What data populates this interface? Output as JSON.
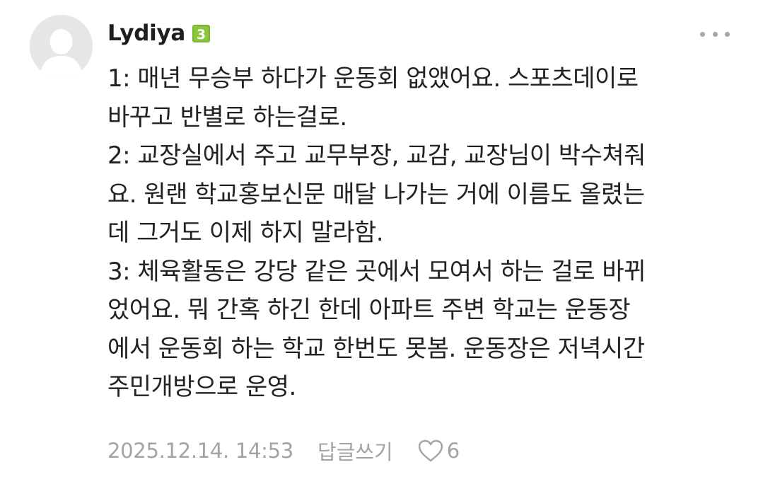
{
  "comment": {
    "author": "Lydiya",
    "level_badge": "3",
    "body_lines": [
      "1: 매년 무승부 하다가 운동회 없앴어요. 스포츠데이로",
      "바꾸고 반별로 하는걸로.",
      "2: 교장실에서 주고 교무부장, 교감, 교장님이 박수쳐줘",
      "요. 원랜 학교홍보신문 매달 나가는 거에 이름도 올렸는",
      "데 그거도 이제 하지 말라함.",
      "3: 체육활동은 강당 같은 곳에서 모여서 하는 걸로 바뀌",
      "었어요. 뭐 간혹 하긴 한데 아파트 주변 학교는 운동장",
      "에서 운동회 하는 학교 한번도 못봄. 운동장은 저녁시간",
      "주민개방으로 운영."
    ],
    "timestamp": "2025.12.14. 14:53",
    "reply_label": "답글쓰기",
    "like_count": "6"
  },
  "icons": {
    "avatar": "default-profile-icon",
    "more": "more-options-icon",
    "like": "heart-outline-icon"
  },
  "colors": {
    "badge": "#8cc63f",
    "text": "#222222",
    "meta": "#a3a3a3",
    "avatar_bg": "#e6e6e6"
  }
}
